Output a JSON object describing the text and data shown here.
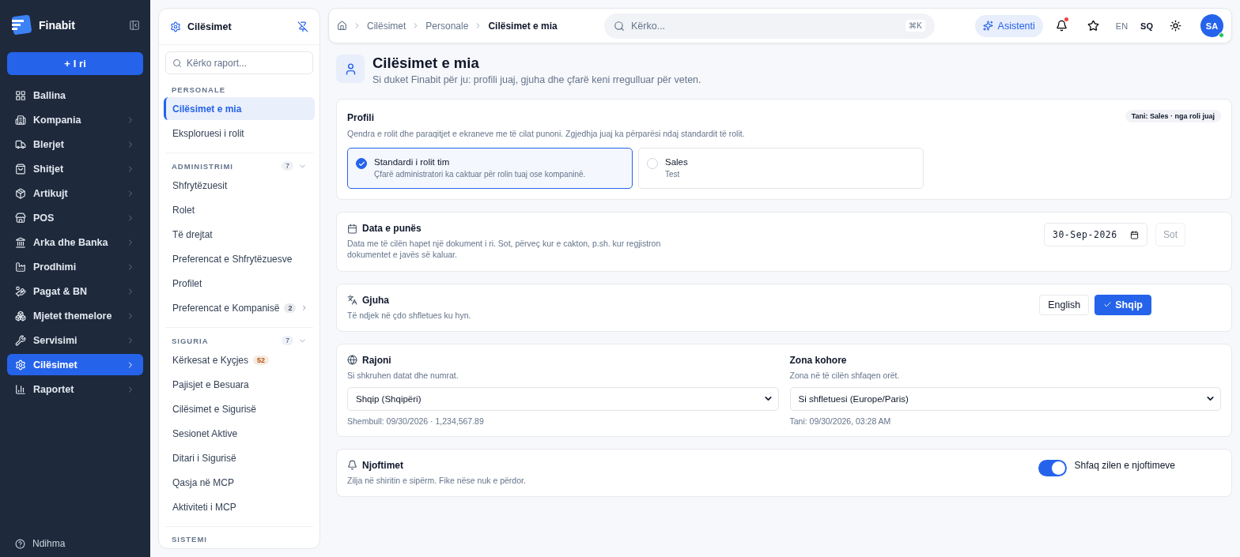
{
  "app": {
    "name": "Finabit"
  },
  "new_button": {
    "icon": "+",
    "label": "I ri"
  },
  "nav": [
    {
      "label": "Ballina",
      "expandable": false,
      "selected": false
    },
    {
      "label": "Kompania",
      "expandable": true,
      "selected": false
    },
    {
      "label": "Blerjet",
      "expandable": true,
      "selected": false
    },
    {
      "label": "Shitjet",
      "expandable": true,
      "selected": false
    },
    {
      "label": "Artikujt",
      "expandable": true,
      "selected": false
    },
    {
      "label": "POS",
      "expandable": true,
      "selected": false
    },
    {
      "label": "Arka dhe Banka",
      "expandable": true,
      "selected": false
    },
    {
      "label": "Prodhimi",
      "expandable": true,
      "selected": false
    },
    {
      "label": "Pagat & BN",
      "expandable": true,
      "selected": false
    },
    {
      "label": "Mjetet themelore",
      "expandable": true,
      "selected": false
    },
    {
      "label": "Servisimi",
      "expandable": true,
      "selected": false
    },
    {
      "label": "Cilësimet",
      "expandable": true,
      "selected": true
    },
    {
      "label": "Raportet",
      "expandable": true,
      "selected": false
    }
  ],
  "help": {
    "label": "Ndihma"
  },
  "settings_panel": {
    "title": "Cilësimet",
    "search_placeholder": "Kërko raport...",
    "sections": [
      {
        "title": "PERSONALE",
        "items": [
          {
            "label": "Cilësimet e mia",
            "selected": true
          },
          {
            "label": "Eksploruesi i rolit",
            "selected": false
          }
        ]
      },
      {
        "title": "ADMINISTRIMI",
        "count": "7",
        "expanded": true,
        "items": [
          {
            "label": "Shfrytëzuesit",
            "selected": false
          },
          {
            "label": "Rolet",
            "selected": false
          },
          {
            "label": "Të drejtat",
            "selected": false
          },
          {
            "label": "Preferencat e Shfrytëzuesve",
            "selected": false
          },
          {
            "label": "Profilet",
            "selected": false
          },
          {
            "label": "Preferencat e Kompanisë",
            "selected": false,
            "badge": {
              "text": "2",
              "color": "#475569"
            },
            "expandable": true
          }
        ]
      },
      {
        "title": "SIGURIA",
        "count": "7",
        "expanded": true,
        "items": [
          {
            "label": "Kërkesat e Kyçjes",
            "selected": false,
            "badge": {
              "text": "52",
              "color": "#b45309"
            }
          },
          {
            "label": "Pajisjet e Besuara",
            "selected": false
          },
          {
            "label": "Cilësimet e Sigurisë",
            "selected": false
          },
          {
            "label": "Sesionet Aktive",
            "selected": false
          },
          {
            "label": "Ditari i Sigurisë",
            "selected": false
          },
          {
            "label": "Qasja në MCP",
            "selected": false
          },
          {
            "label": "Aktiviteti i MCP",
            "selected": false
          }
        ]
      },
      {
        "title": "SISTEMI"
      }
    ]
  },
  "topbar": {
    "breadcrumbs": [
      "Cilësimet",
      "Personale",
      "Cilësimet e mia"
    ],
    "search_placeholder": "Kërko...",
    "shortcut": "⌘K",
    "assistant": "Asistenti",
    "has_notifications": true,
    "languages": [
      {
        "label": "EN",
        "selected": false
      },
      {
        "label": "SQ",
        "selected": true
      }
    ],
    "avatar": {
      "initials": "SA",
      "online": true
    }
  },
  "page": {
    "title": "Cilësimet e mia",
    "subtitle": "Si duket Finabit për ju: profili juaj, gjuha dhe çfarë keni rregulluar për veten."
  },
  "profile": {
    "title": "Profili",
    "description": "Qendra e rolit dhe paraqitjet e ekraneve me të cilat punoni. Zgjedhja juaj ka përparësi ndaj standardit të rolit.",
    "badge": "Tani: Sales · nga roli juaj",
    "options": [
      {
        "title": "Standardi i rolit tim",
        "description": "Çfarë administratori ka caktuar për rolin tuaj ose kompaninë.",
        "selected": true
      },
      {
        "title": "Sales",
        "description": "Test",
        "selected": false
      }
    ]
  },
  "work_date": {
    "title": "Data e punës",
    "description": "Data me të cilën hapet një dokument i ri. Sot, përveç kur e cakton, p.sh. kur regjistron dokumentet e javës së kaluar.",
    "value": "30-Sep-2026",
    "today_button": "Sot",
    "today_disabled": true
  },
  "language": {
    "title": "Gjuha",
    "description": "Të ndjek në çdo shfletues ku hyn.",
    "options": [
      {
        "label": "English",
        "selected": false
      },
      {
        "label": "Shqip",
        "selected": true
      }
    ]
  },
  "region": {
    "title": "Rajoni",
    "description": "Si shkruhen datat dhe numrat.",
    "value": "Shqip (Shqipëri)",
    "example": "Shembull: 09/30/2026 · 1,234,567.89"
  },
  "timezone": {
    "title": "Zona kohore",
    "description": "Zona në të cilën shfaqen orët.",
    "value": "Si shfletuesi (Europe/Paris)",
    "now": "Tani: 09/30/2026, 03:28 AM"
  },
  "notifications": {
    "title": "Njoftimet",
    "description": "Zilja në shiritin e sipërm. Fike nëse nuk e përdor.",
    "toggle_label": "Shfaq zilen e njoftimeve",
    "on": true
  }
}
